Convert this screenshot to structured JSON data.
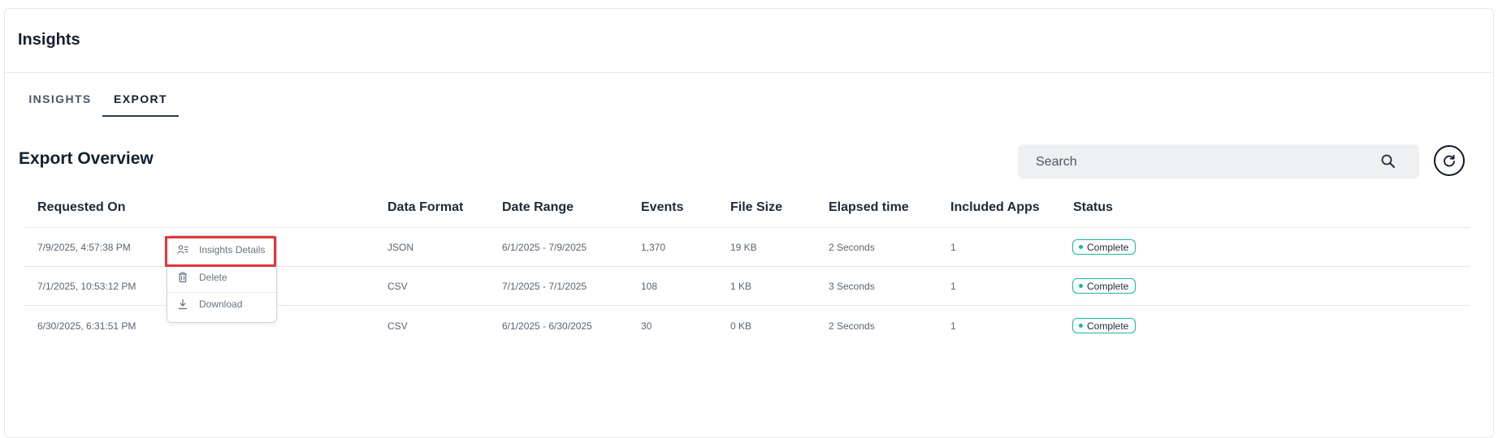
{
  "header": {
    "title": "Insights"
  },
  "tabs": [
    {
      "label": "INSIGHTS",
      "active": false
    },
    {
      "label": "EXPORT",
      "active": true
    }
  ],
  "section": {
    "title": "Export Overview"
  },
  "search": {
    "placeholder": "Search",
    "value": "",
    "icon": "search-icon"
  },
  "refresh": {
    "icon": "refresh-icon"
  },
  "table": {
    "columns": [
      "Requested On",
      "Data Format",
      "Date Range",
      "Events",
      "File Size",
      "Elapsed time",
      "Included Apps",
      "Status"
    ],
    "rows": [
      {
        "requested_on": "7/9/2025, 4:57:38 PM",
        "data_format": "JSON",
        "date_range": "6/1/2025 - 7/9/2025",
        "events": "1,370",
        "file_size": "19 KB",
        "elapsed_time": "2 Seconds",
        "included_apps": "1",
        "status": "Complete"
      },
      {
        "requested_on": "7/1/2025, 10:53:12 PM",
        "data_format": "CSV",
        "date_range": "7/1/2025 - 7/1/2025",
        "events": "108",
        "file_size": "1 KB",
        "elapsed_time": "3 Seconds",
        "included_apps": "1",
        "status": "Complete"
      },
      {
        "requested_on": "6/30/2025, 6:31:51 PM",
        "data_format": "CSV",
        "date_range": "6/1/2025 - 6/30/2025",
        "events": "30",
        "file_size": "0 KB",
        "elapsed_time": "2 Seconds",
        "included_apps": "1",
        "status": "Complete"
      }
    ]
  },
  "context_menu": {
    "items": [
      {
        "label": "Insights Details",
        "icon": "user-details-icon",
        "highlighted": true
      },
      {
        "label": "Delete",
        "icon": "trash-icon"
      },
      {
        "label": "Download",
        "icon": "download-icon"
      }
    ]
  },
  "colors": {
    "status_accent": "#19b89a",
    "highlight": "#e0363d",
    "search_bg": "#eef0f1"
  }
}
